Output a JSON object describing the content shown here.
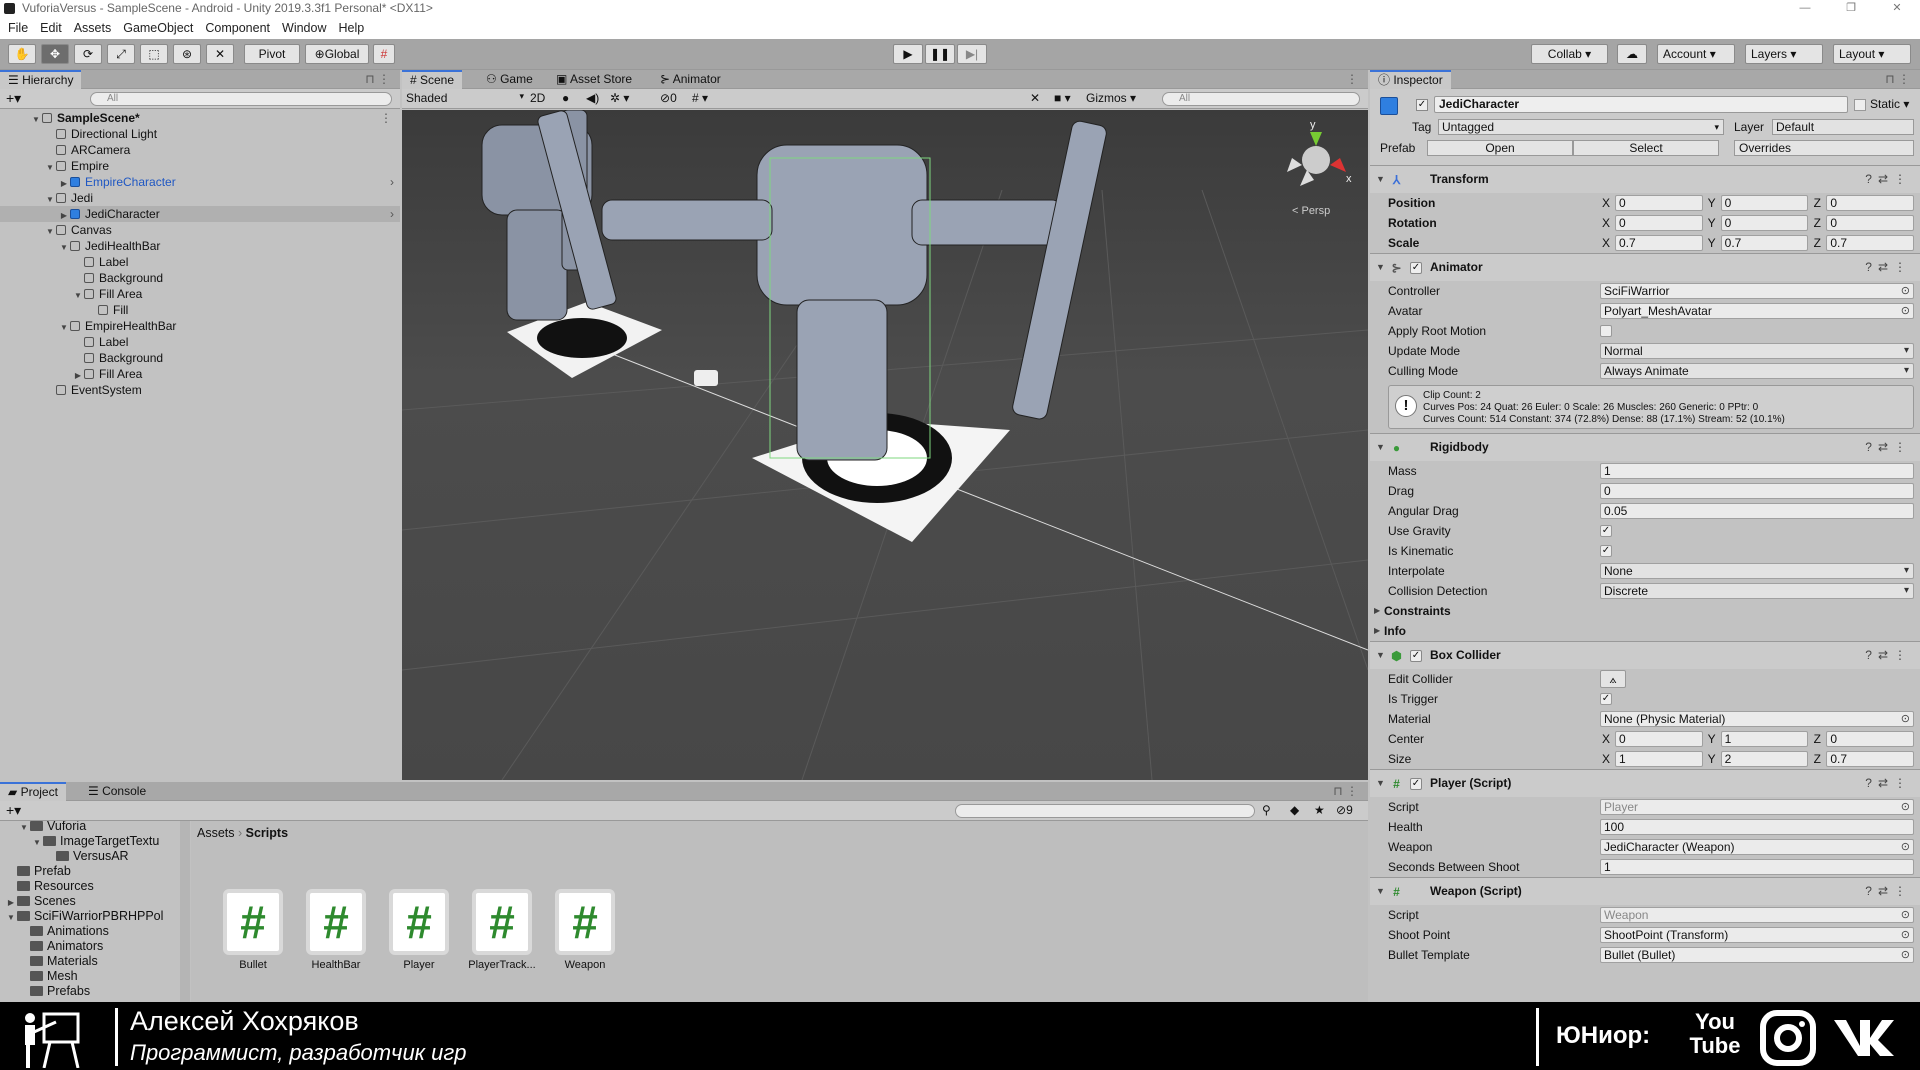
{
  "window": {
    "title": "VuforiaVersus - SampleScene - Android - Unity 2019.3.3f1 Personal* <DX11>",
    "controls": [
      "—",
      "❐",
      "✕"
    ]
  },
  "menu": [
    "File",
    "Edit",
    "Assets",
    "GameObject",
    "Component",
    "Window",
    "Help"
  ],
  "toolbar": {
    "pivot": "Pivot",
    "global": "Global",
    "collab": "Collab ▾",
    "account": "Account",
    "layers": "Layers",
    "layout": "Layout"
  },
  "hierarchy": {
    "tab": "Hierarchy",
    "search_placeholder": "All",
    "items": [
      {
        "label": "SampleScene*",
        "depth": 0,
        "arrow": "▼",
        "bold": true,
        "kind": "scene"
      },
      {
        "label": "Directional Light",
        "depth": 1,
        "arrow": ""
      },
      {
        "label": "ARCamera",
        "depth": 1,
        "arrow": ""
      },
      {
        "label": "Empire",
        "depth": 1,
        "arrow": "▼"
      },
      {
        "label": "EmpireCharacter",
        "depth": 2,
        "arrow": "▶",
        "prefab": true
      },
      {
        "label": "Jedi",
        "depth": 1,
        "arrow": "▼"
      },
      {
        "label": "JediCharacter",
        "depth": 2,
        "arrow": "▶",
        "prefab": true,
        "selected": true
      },
      {
        "label": "Canvas",
        "depth": 1,
        "arrow": "▼"
      },
      {
        "label": "JediHealthBar",
        "depth": 2,
        "arrow": "▼"
      },
      {
        "label": "Label",
        "depth": 3,
        "arrow": ""
      },
      {
        "label": "Background",
        "depth": 3,
        "arrow": ""
      },
      {
        "label": "Fill Area",
        "depth": 3,
        "arrow": "▼"
      },
      {
        "label": "Fill",
        "depth": 4,
        "arrow": ""
      },
      {
        "label": "EmpireHealthBar",
        "depth": 2,
        "arrow": "▼"
      },
      {
        "label": "Label",
        "depth": 3,
        "arrow": ""
      },
      {
        "label": "Background",
        "depth": 3,
        "arrow": ""
      },
      {
        "label": "Fill Area",
        "depth": 3,
        "arrow": "▶"
      },
      {
        "label": "EventSystem",
        "depth": 1,
        "arrow": ""
      }
    ]
  },
  "scene": {
    "tabs": [
      "# Scene",
      "Game",
      "Asset Store",
      "Animator"
    ],
    "shading": "Shaded",
    "mode_2d": "2D",
    "hidden_count": "0",
    "gizmos": "Gizmos",
    "search_placeholder": "All",
    "persp": "< Persp",
    "axis_y": "y",
    "axis_x": "x"
  },
  "inspector": {
    "tab": "Inspector",
    "object_name": "JediCharacter",
    "static_label": "Static",
    "tag_label": "Tag",
    "tag": "Untagged",
    "layer_label": "Layer",
    "layer": "Default",
    "prefab_label": "Prefab",
    "open": "Open",
    "select": "Select",
    "overrides": "Overrides",
    "components": [
      {
        "name": "Transform",
        "icon": "transform-icon",
        "glyph": "⅄",
        "color": "#3a6fd8",
        "checkbox": false,
        "rows": [
          {
            "label": "Position",
            "type": "xyz",
            "x": "0",
            "y": "0",
            "z": "0",
            "bold": true
          },
          {
            "label": "Rotation",
            "type": "xyz",
            "x": "0",
            "y": "0",
            "z": "0",
            "bold": true
          },
          {
            "label": "Scale",
            "type": "xyz",
            "x": "0.7",
            "y": "0.7",
            "z": "0.7",
            "bold": true
          }
        ]
      },
      {
        "name": "Animator",
        "icon": "animator-icon",
        "glyph": "⊱",
        "color": "#555",
        "checkbox": true,
        "rows": [
          {
            "label": "Controller",
            "type": "obj",
            "value": "SciFiWarrior"
          },
          {
            "label": "Avatar",
            "type": "obj",
            "value": "Polyart_MeshAvatar"
          },
          {
            "label": "Apply Root Motion",
            "type": "check",
            "checked": false
          },
          {
            "label": "Update Mode",
            "type": "drop",
            "value": "Normal"
          },
          {
            "label": "Culling Mode",
            "type": "drop",
            "value": "Always Animate"
          },
          {
            "type": "help",
            "lines": [
              "Clip Count: 2",
              "Curves Pos: 24 Quat: 26 Euler: 0 Scale: 26 Muscles: 260 Generic: 0 PPtr: 0",
              "Curves Count: 514 Constant: 374 (72.8%) Dense: 88 (17.1%) Stream: 52 (10.1%)"
            ]
          }
        ]
      },
      {
        "name": "Rigidbody",
        "icon": "rigidbody-icon",
        "glyph": "●",
        "color": "#3a9a3a",
        "checkbox": false,
        "rows": [
          {
            "label": "Mass",
            "type": "text",
            "value": "1"
          },
          {
            "label": "Drag",
            "type": "text",
            "value": "0"
          },
          {
            "label": "Angular Drag",
            "type": "text",
            "value": "0.05"
          },
          {
            "label": "Use Gravity",
            "type": "check",
            "checked": true
          },
          {
            "label": "Is Kinematic",
            "type": "check",
            "checked": true
          },
          {
            "label": "Interpolate",
            "type": "drop",
            "value": "None"
          },
          {
            "label": "Collision Detection",
            "type": "drop",
            "value": "Discrete"
          },
          {
            "label": "Constraints",
            "type": "fold"
          },
          {
            "label": "Info",
            "type": "fold"
          }
        ]
      },
      {
        "name": "Box Collider",
        "icon": "box-collider-icon",
        "glyph": "⬢",
        "color": "#3a9a3a",
        "checkbox": true,
        "rows": [
          {
            "label": "Edit Collider",
            "type": "button",
            "value": "⟑"
          },
          {
            "label": "Is Trigger",
            "type": "check",
            "checked": true
          },
          {
            "label": "Material",
            "type": "obj",
            "value": "None (Physic Material)"
          },
          {
            "label": "Center",
            "type": "xyz",
            "x": "0",
            "y": "1",
            "z": "0"
          },
          {
            "label": "Size",
            "type": "xyz",
            "x": "1",
            "y": "2",
            "z": "0.7"
          }
        ]
      },
      {
        "name": "Player (Script)",
        "icon": "script-icon",
        "glyph": "#",
        "color": "#2e8a2e",
        "checkbox": true,
        "rows": [
          {
            "label": "Script",
            "type": "obj",
            "value": "Player",
            "disabled": true
          },
          {
            "label": "Health",
            "type": "text",
            "value": "100"
          },
          {
            "label": "Weapon",
            "type": "obj",
            "value": "JediCharacter (Weapon)"
          },
          {
            "label": "Seconds Between Shoot",
            "type": "text",
            "value": "1"
          }
        ]
      },
      {
        "name": "Weapon (Script)",
        "icon": "script-icon",
        "glyph": "#",
        "color": "#2e8a2e",
        "checkbox": false,
        "rows": [
          {
            "label": "Script",
            "type": "obj",
            "value": "Weapon",
            "disabled": true
          },
          {
            "label": "Shoot Point",
            "type": "obj",
            "value": "ShootPoint (Transform)"
          },
          {
            "label": "Bullet Template",
            "type": "obj",
            "value": "Bullet (Bullet)"
          }
        ]
      }
    ]
  },
  "project": {
    "tabs": [
      "Project",
      "Console"
    ],
    "hidden_count": "9",
    "breadcrumb": [
      "Assets",
      "Scripts"
    ],
    "tree": [
      {
        "label": "Vuforia",
        "indent": 2,
        "arrow": "▼",
        "open": true
      },
      {
        "label": "ImageTargetTextu",
        "indent": 3,
        "arrow": "▼",
        "open": true
      },
      {
        "label": "VersusAR",
        "indent": 4,
        "arrow": ""
      },
      {
        "label": "Prefab",
        "indent": 1,
        "arrow": ""
      },
      {
        "label": "Resources",
        "indent": 1,
        "arrow": ""
      },
      {
        "label": "Scenes",
        "indent": 1,
        "arrow": "▶"
      },
      {
        "label": "SciFiWarriorPBRHPPol",
        "indent": 1,
        "arrow": "▼",
        "open": true
      },
      {
        "label": "Animations",
        "indent": 2,
        "arrow": ""
      },
      {
        "label": "Animators",
        "indent": 2,
        "arrow": ""
      },
      {
        "label": "Materials",
        "indent": 2,
        "arrow": ""
      },
      {
        "label": "Mesh",
        "indent": 2,
        "arrow": ""
      },
      {
        "label": "Prefabs",
        "indent": 2,
        "arrow": ""
      }
    ],
    "assets": [
      "Bullet",
      "HealthBar",
      "Player",
      "PlayerTrack...",
      "Weapon"
    ]
  },
  "banner": {
    "name": "Алексей Хохряков",
    "subtitle": "Программист, разработчик игр",
    "brand": "ЮНиор:",
    "youtube": "You Tube"
  }
}
